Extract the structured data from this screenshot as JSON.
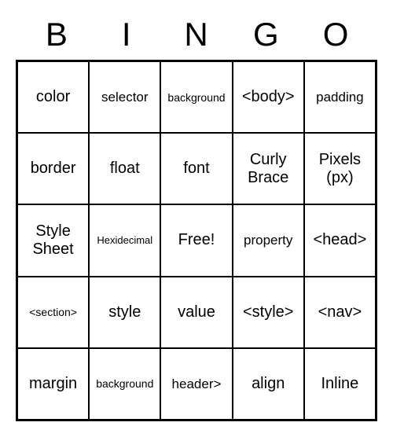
{
  "header": [
    "B",
    "I",
    "N",
    "G",
    "O"
  ],
  "grid": [
    [
      {
        "text": "color",
        "size": ""
      },
      {
        "text": "selector",
        "size": "medium"
      },
      {
        "text": "background",
        "size": "small"
      },
      {
        "text": "<body>",
        "size": ""
      },
      {
        "text": "padding",
        "size": "medium"
      }
    ],
    [
      {
        "text": "border",
        "size": ""
      },
      {
        "text": "float",
        "size": ""
      },
      {
        "text": "font",
        "size": ""
      },
      {
        "text": "Curly Brace",
        "size": ""
      },
      {
        "text": "Pixels (px)",
        "size": ""
      }
    ],
    [
      {
        "text": "Style Sheet",
        "size": ""
      },
      {
        "text": "Hexidecimal",
        "size": "smaller"
      },
      {
        "text": "Free!",
        "size": ""
      },
      {
        "text": "property",
        "size": "medium"
      },
      {
        "text": "<head>",
        "size": ""
      }
    ],
    [
      {
        "text": "<section>",
        "size": "small"
      },
      {
        "text": "style",
        "size": ""
      },
      {
        "text": "value",
        "size": ""
      },
      {
        "text": "<style>",
        "size": ""
      },
      {
        "text": "<nav>",
        "size": ""
      }
    ],
    [
      {
        "text": "margin",
        "size": ""
      },
      {
        "text": "background",
        "size": "small"
      },
      {
        "text": "header>",
        "size": "medium"
      },
      {
        "text": "align",
        "size": ""
      },
      {
        "text": "Inline",
        "size": ""
      }
    ]
  ]
}
